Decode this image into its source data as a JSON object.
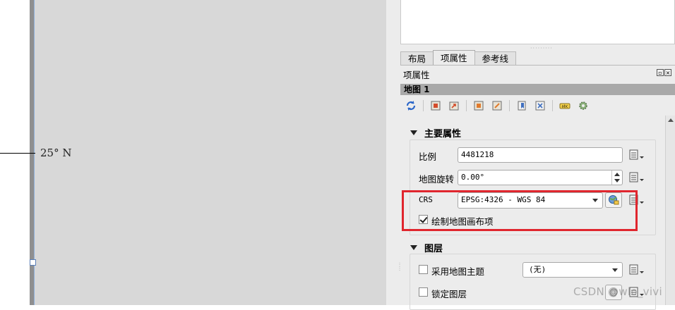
{
  "canvas": {
    "grid_label": "25° N"
  },
  "panel": {
    "tabs": [
      {
        "label": "布局"
      },
      {
        "label": "项属性"
      },
      {
        "label": "参考线"
      }
    ],
    "dock_title": "项属性",
    "item_header": "地图 1",
    "toolbar_icons": [
      "refresh-icon",
      "set-extent-icon",
      "view-extent-icon",
      "move-content-icon",
      "zoom-content-icon",
      "bookmark-icon",
      "atlas-icon",
      "label-icon",
      "settings-gear-icon"
    ],
    "main_props": {
      "title": "主要属性",
      "scale_label": "比例",
      "scale_value": "4481218",
      "rotation_label": "地图旋转",
      "rotation_value": "0.00°",
      "crs_label": "CRS",
      "crs_value": "EPSG:4326 - WGS 84",
      "draw_items_label": "绘制地图画布项",
      "draw_items_checked": true
    },
    "layers": {
      "title": "图层",
      "follow_theme_label": "采用地图主题",
      "follow_theme_checked": false,
      "theme_value": "(无)",
      "lock_layers_label": "锁定图层",
      "lock_layers_checked": false
    }
  },
  "watermark": "CSDN @wlo_vivi",
  "colors": {
    "highlight": "#e0262e",
    "map_frame": "#d8d8d8",
    "header_bar": "#a9a9a9"
  }
}
